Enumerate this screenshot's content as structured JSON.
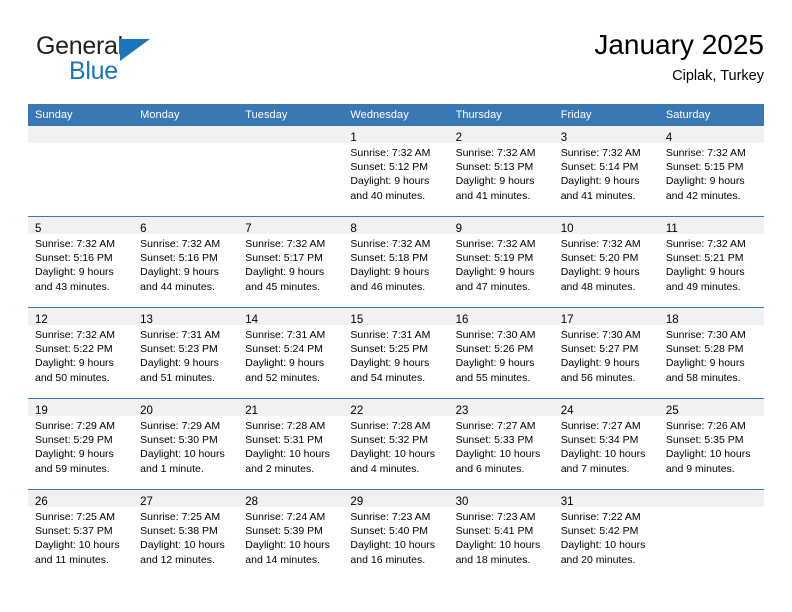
{
  "brand": {
    "line1": "General",
    "line2": "Blue",
    "flag_icon": "triangle-flag-icon",
    "color_dark": "#231f20",
    "color_blue": "#1b75bb"
  },
  "header": {
    "month_title": "January 2025",
    "location": "Ciplak, Turkey"
  },
  "colors": {
    "header_row_bg": "#3878b4",
    "daynum_strip_bg": "#f1f1f1",
    "grid_line": "#3878b4",
    "page_bg": "#ffffff",
    "text": "#000000"
  },
  "weekday_headers": [
    "Sunday",
    "Monday",
    "Tuesday",
    "Wednesday",
    "Thursday",
    "Friday",
    "Saturday"
  ],
  "weeks": [
    [
      {
        "day": "",
        "lines": []
      },
      {
        "day": "",
        "lines": []
      },
      {
        "day": "",
        "lines": []
      },
      {
        "day": "1",
        "lines": [
          "Sunrise: 7:32 AM",
          "Sunset: 5:12 PM",
          "Daylight: 9 hours",
          "and 40 minutes."
        ]
      },
      {
        "day": "2",
        "lines": [
          "Sunrise: 7:32 AM",
          "Sunset: 5:13 PM",
          "Daylight: 9 hours",
          "and 41 minutes."
        ]
      },
      {
        "day": "3",
        "lines": [
          "Sunrise: 7:32 AM",
          "Sunset: 5:14 PM",
          "Daylight: 9 hours",
          "and 41 minutes."
        ]
      },
      {
        "day": "4",
        "lines": [
          "Sunrise: 7:32 AM",
          "Sunset: 5:15 PM",
          "Daylight: 9 hours",
          "and 42 minutes."
        ]
      }
    ],
    [
      {
        "day": "5",
        "lines": [
          "Sunrise: 7:32 AM",
          "Sunset: 5:16 PM",
          "Daylight: 9 hours",
          "and 43 minutes."
        ]
      },
      {
        "day": "6",
        "lines": [
          "Sunrise: 7:32 AM",
          "Sunset: 5:16 PM",
          "Daylight: 9 hours",
          "and 44 minutes."
        ]
      },
      {
        "day": "7",
        "lines": [
          "Sunrise: 7:32 AM",
          "Sunset: 5:17 PM",
          "Daylight: 9 hours",
          "and 45 minutes."
        ]
      },
      {
        "day": "8",
        "lines": [
          "Sunrise: 7:32 AM",
          "Sunset: 5:18 PM",
          "Daylight: 9 hours",
          "and 46 minutes."
        ]
      },
      {
        "day": "9",
        "lines": [
          "Sunrise: 7:32 AM",
          "Sunset: 5:19 PM",
          "Daylight: 9 hours",
          "and 47 minutes."
        ]
      },
      {
        "day": "10",
        "lines": [
          "Sunrise: 7:32 AM",
          "Sunset: 5:20 PM",
          "Daylight: 9 hours",
          "and 48 minutes."
        ]
      },
      {
        "day": "11",
        "lines": [
          "Sunrise: 7:32 AM",
          "Sunset: 5:21 PM",
          "Daylight: 9 hours",
          "and 49 minutes."
        ]
      }
    ],
    [
      {
        "day": "12",
        "lines": [
          "Sunrise: 7:32 AM",
          "Sunset: 5:22 PM",
          "Daylight: 9 hours",
          "and 50 minutes."
        ]
      },
      {
        "day": "13",
        "lines": [
          "Sunrise: 7:31 AM",
          "Sunset: 5:23 PM",
          "Daylight: 9 hours",
          "and 51 minutes."
        ]
      },
      {
        "day": "14",
        "lines": [
          "Sunrise: 7:31 AM",
          "Sunset: 5:24 PM",
          "Daylight: 9 hours",
          "and 52 minutes."
        ]
      },
      {
        "day": "15",
        "lines": [
          "Sunrise: 7:31 AM",
          "Sunset: 5:25 PM",
          "Daylight: 9 hours",
          "and 54 minutes."
        ]
      },
      {
        "day": "16",
        "lines": [
          "Sunrise: 7:30 AM",
          "Sunset: 5:26 PM",
          "Daylight: 9 hours",
          "and 55 minutes."
        ]
      },
      {
        "day": "17",
        "lines": [
          "Sunrise: 7:30 AM",
          "Sunset: 5:27 PM",
          "Daylight: 9 hours",
          "and 56 minutes."
        ]
      },
      {
        "day": "18",
        "lines": [
          "Sunrise: 7:30 AM",
          "Sunset: 5:28 PM",
          "Daylight: 9 hours",
          "and 58 minutes."
        ]
      }
    ],
    [
      {
        "day": "19",
        "lines": [
          "Sunrise: 7:29 AM",
          "Sunset: 5:29 PM",
          "Daylight: 9 hours",
          "and 59 minutes."
        ]
      },
      {
        "day": "20",
        "lines": [
          "Sunrise: 7:29 AM",
          "Sunset: 5:30 PM",
          "Daylight: 10 hours",
          "and 1 minute."
        ]
      },
      {
        "day": "21",
        "lines": [
          "Sunrise: 7:28 AM",
          "Sunset: 5:31 PM",
          "Daylight: 10 hours",
          "and 2 minutes."
        ]
      },
      {
        "day": "22",
        "lines": [
          "Sunrise: 7:28 AM",
          "Sunset: 5:32 PM",
          "Daylight: 10 hours",
          "and 4 minutes."
        ]
      },
      {
        "day": "23",
        "lines": [
          "Sunrise: 7:27 AM",
          "Sunset: 5:33 PM",
          "Daylight: 10 hours",
          "and 6 minutes."
        ]
      },
      {
        "day": "24",
        "lines": [
          "Sunrise: 7:27 AM",
          "Sunset: 5:34 PM",
          "Daylight: 10 hours",
          "and 7 minutes."
        ]
      },
      {
        "day": "25",
        "lines": [
          "Sunrise: 7:26 AM",
          "Sunset: 5:35 PM",
          "Daylight: 10 hours",
          "and 9 minutes."
        ]
      }
    ],
    [
      {
        "day": "26",
        "lines": [
          "Sunrise: 7:25 AM",
          "Sunset: 5:37 PM",
          "Daylight: 10 hours",
          "and 11 minutes."
        ]
      },
      {
        "day": "27",
        "lines": [
          "Sunrise: 7:25 AM",
          "Sunset: 5:38 PM",
          "Daylight: 10 hours",
          "and 12 minutes."
        ]
      },
      {
        "day": "28",
        "lines": [
          "Sunrise: 7:24 AM",
          "Sunset: 5:39 PM",
          "Daylight: 10 hours",
          "and 14 minutes."
        ]
      },
      {
        "day": "29",
        "lines": [
          "Sunrise: 7:23 AM",
          "Sunset: 5:40 PM",
          "Daylight: 10 hours",
          "and 16 minutes."
        ]
      },
      {
        "day": "30",
        "lines": [
          "Sunrise: 7:23 AM",
          "Sunset: 5:41 PM",
          "Daylight: 10 hours",
          "and 18 minutes."
        ]
      },
      {
        "day": "31",
        "lines": [
          "Sunrise: 7:22 AM",
          "Sunset: 5:42 PM",
          "Daylight: 10 hours",
          "and 20 minutes."
        ]
      },
      {
        "day": "",
        "lines": []
      }
    ]
  ]
}
